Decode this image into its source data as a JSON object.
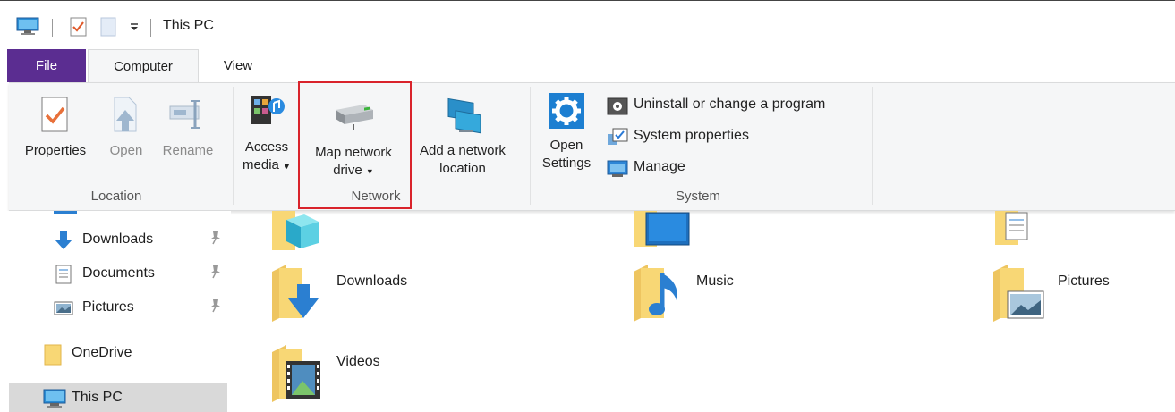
{
  "window": {
    "title": "This PC"
  },
  "tabs": {
    "file": "File",
    "computer": "Computer",
    "view": "View"
  },
  "ribbon": {
    "location": {
      "group_label": "Location",
      "properties": "Properties",
      "open": "Open",
      "rename": "Rename"
    },
    "network": {
      "group_label": "Network",
      "access_media_line1": "Access",
      "access_media_line2": "media",
      "map_network_drive_line1": "Map network",
      "map_network_drive_line2": "drive",
      "add_network_location_line1": "Add a network",
      "add_network_location_line2": "location"
    },
    "system": {
      "group_label": "System",
      "open_settings_line1": "Open",
      "open_settings_line2": "Settings",
      "uninstall": "Uninstall or change a program",
      "system_properties": "System properties",
      "manage": "Manage"
    }
  },
  "nav": {
    "items": [
      {
        "label": "Downloads",
        "pinned": true,
        "icon": "download-arrow-icon"
      },
      {
        "label": "Documents",
        "pinned": true,
        "icon": "document-icon"
      },
      {
        "label": "Pictures",
        "pinned": true,
        "icon": "picture-icon"
      },
      {
        "label": "OneDrive",
        "pinned": false,
        "icon": "folder-icon"
      },
      {
        "label": "This PC",
        "pinned": false,
        "icon": "monitor-icon",
        "selected": true
      }
    ],
    "pin_glyph": "📌"
  },
  "folders": [
    {
      "label": "Downloads",
      "icon": "downloads-folder-icon"
    },
    {
      "label": "Music",
      "icon": "music-folder-icon"
    },
    {
      "label": "Pictures",
      "icon": "pictures-folder-icon"
    },
    {
      "label": "Videos",
      "icon": "videos-folder-icon"
    }
  ],
  "colors": {
    "file_tab": "#5b2d91",
    "highlight_border": "#d9232b",
    "ribbon_bg": "#f5f6f7",
    "folder_yellow": "#f8d775",
    "selection": "#d9d9d9"
  }
}
